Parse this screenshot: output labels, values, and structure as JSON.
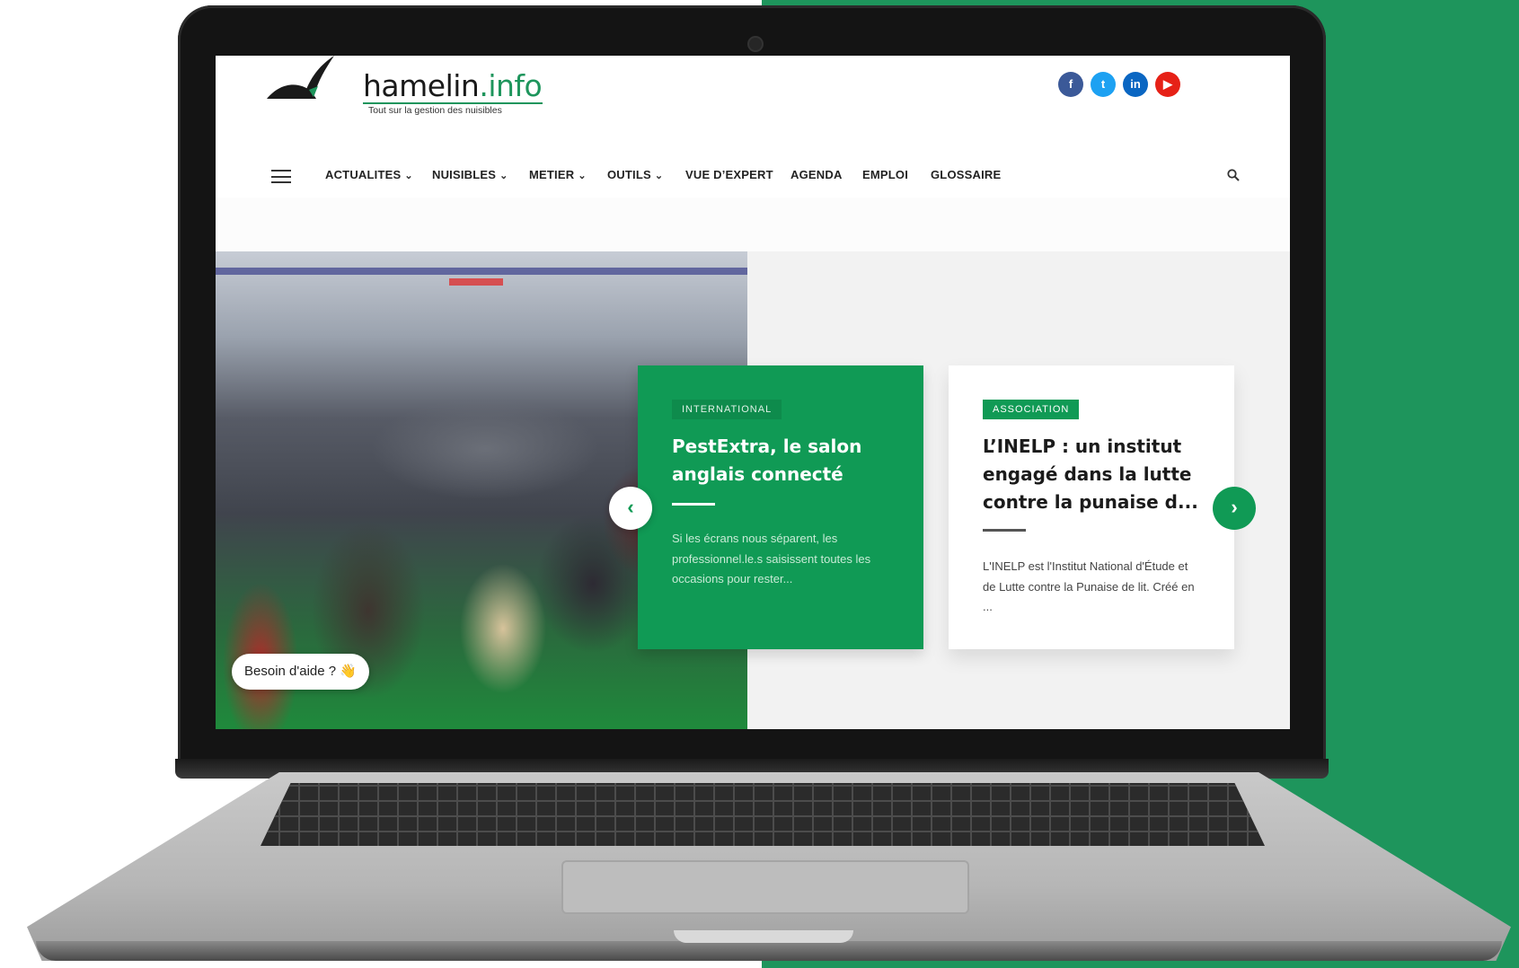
{
  "site": {
    "logo_text": "hamelin",
    "logo_domain": ".info",
    "tagline": "Tout sur la gestion des nuisibles"
  },
  "social": [
    {
      "label": "f",
      "icon": "facebook-icon",
      "color": "#3b5998"
    },
    {
      "label": "t",
      "icon": "twitter-icon",
      "color": "#1da1f2"
    },
    {
      "label": "in",
      "icon": "linkedin-icon",
      "color": "#0a66c2"
    },
    {
      "label": "▶",
      "icon": "youtube-icon",
      "color": "#e62117"
    }
  ],
  "nav": {
    "items": [
      {
        "label": "ACTUALITES",
        "dropdown": true
      },
      {
        "label": "NUISIBLES",
        "dropdown": true
      },
      {
        "label": "METIER",
        "dropdown": true
      },
      {
        "label": "OUTILS",
        "dropdown": true
      },
      {
        "label": "VUE D’EXPERT",
        "dropdown": false
      },
      {
        "label": "AGENDA",
        "dropdown": false
      },
      {
        "label": "EMPLOI",
        "dropdown": false
      },
      {
        "label": "GLOSSAIRE",
        "dropdown": false
      }
    ],
    "chevron": "⌄"
  },
  "slider": {
    "prev_label": "‹",
    "next_label": "›",
    "cards": [
      {
        "tag": "INTERNATIONAL",
        "title": "PestExtra, le salon anglais connecté",
        "excerpt": "Si les écrans nous séparent, les professionnel.le.s saisissent toutes les occasions pour rester..."
      },
      {
        "tag": "ASSOCIATION",
        "title": "L’INELP : un institut engagé dans la lutte contre la punaise d...",
        "excerpt": "L'INELP est l'Institut National d'Étude et de Lutte contre la Punaise de lit. Créé en ..."
      }
    ]
  },
  "help": {
    "label": "Besoin d'aide ? 👋"
  },
  "colors": {
    "brand_green": "#109a55",
    "background_green": "#1e955c"
  }
}
